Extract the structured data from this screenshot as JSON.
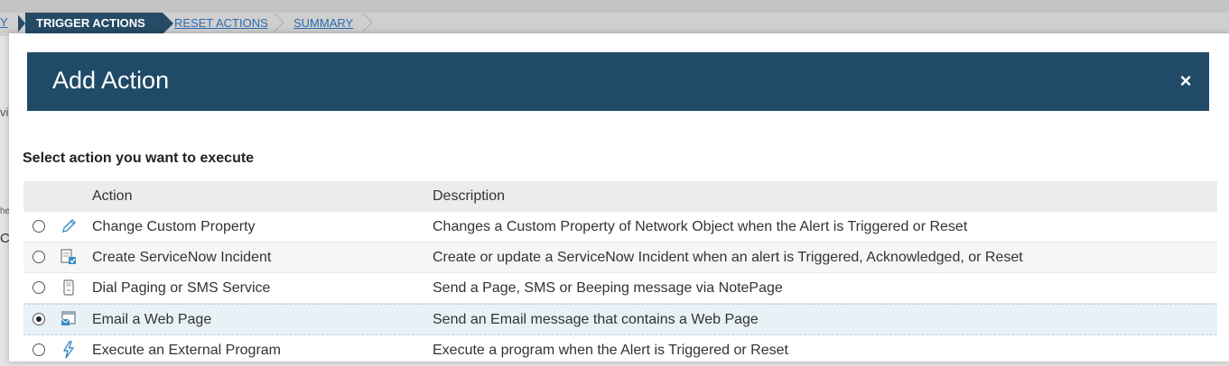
{
  "wizard": {
    "prev_crumb": "Y",
    "active_step": "TRIGGER ACTIONS",
    "steps": [
      "RESET ACTIONS",
      "SUMMARY"
    ],
    "background_fragments": [
      "vi",
      "he",
      "C"
    ]
  },
  "modal": {
    "title": "Add Action",
    "close_label": "×",
    "instructions": "Select action you want to execute",
    "columns": {
      "action": "Action",
      "description": "Description"
    },
    "rows": [
      {
        "action": "Change Custom Property",
        "description": "Changes a Custom Property of Network Object when the Alert is Triggered or Reset",
        "icon": "pencil-icon",
        "selected": false
      },
      {
        "action": "Create ServiceNow Incident",
        "description": "Create or update a ServiceNow Incident when an alert is Triggered, Acknowledged, or Reset",
        "icon": "servicenow-icon",
        "selected": false
      },
      {
        "action": "Dial Paging or SMS Service",
        "description": "Send a Page, SMS or Beeping message via NotePage",
        "icon": "pager-icon",
        "selected": false
      },
      {
        "action": "Email a Web Page",
        "description": "Send an Email message that contains a Web Page",
        "icon": "email-webpage-icon",
        "selected": true
      },
      {
        "action": "Execute an External Program",
        "description": "Execute a program when the Alert is Triggered or Reset",
        "icon": "lightning-icon",
        "selected": false
      }
    ]
  },
  "colors": {
    "header_bg": "#204a67",
    "link": "#2a6db0",
    "selected_row": "#e7f1f6"
  }
}
